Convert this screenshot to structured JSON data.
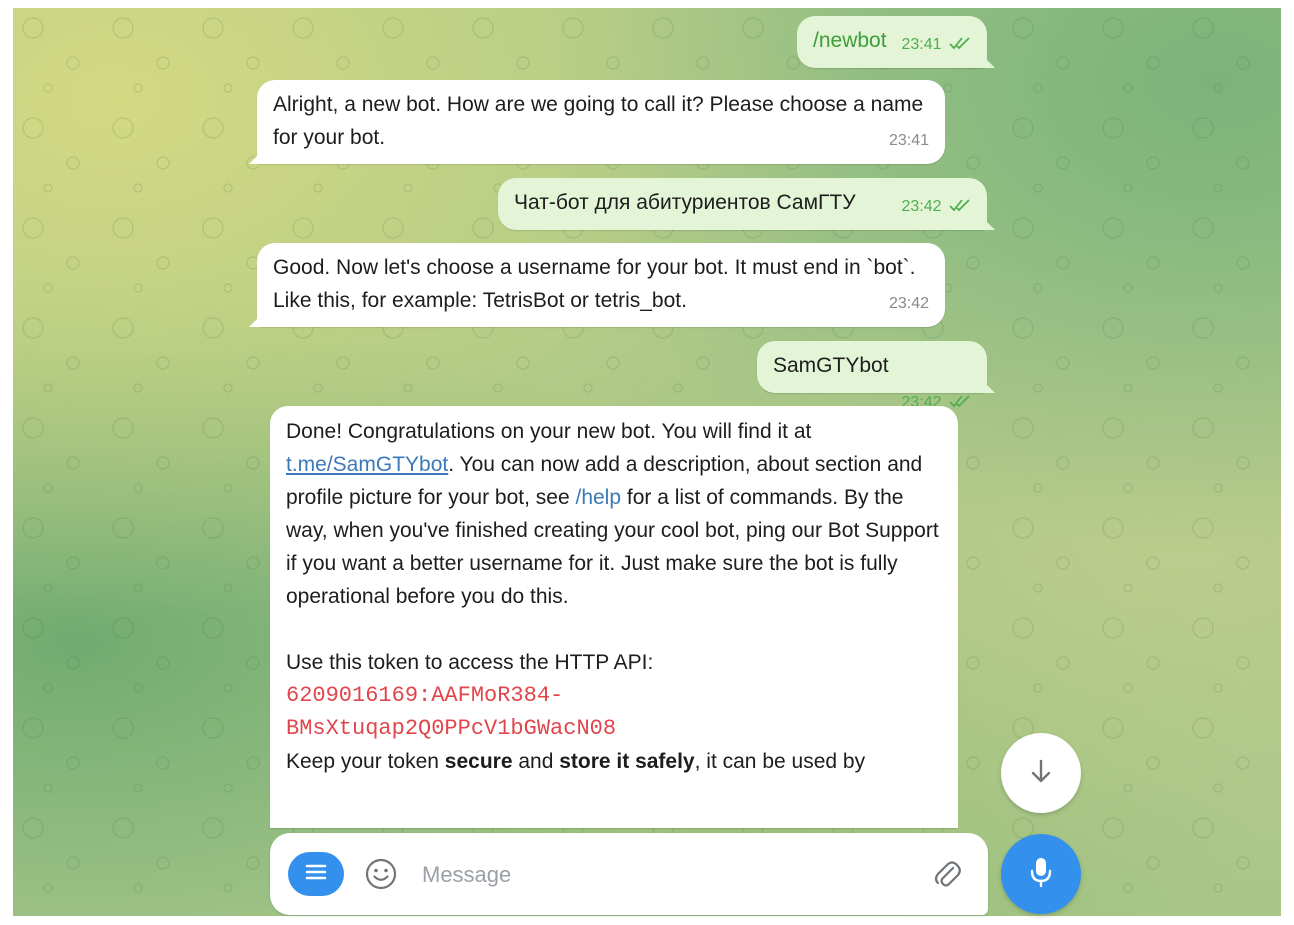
{
  "messages": [
    {
      "direction": "out",
      "text": "/newbot",
      "time": "23:41"
    },
    {
      "direction": "in",
      "text": "Alright, a new bot. How are we going to call it? Please choose a name for your bot.",
      "time": "23:41"
    },
    {
      "direction": "out",
      "text": "Чат-бот для абитуриентов СамГТУ",
      "time": "23:42"
    },
    {
      "direction": "in",
      "text": "Good. Now let's choose a username for your bot. It must end in `bot`. Like this, for example: TetrisBot or tetris_bot.",
      "time": "23:42"
    },
    {
      "direction": "out",
      "text": "SamGTYbot",
      "time": "23:42"
    }
  ],
  "done_message": {
    "p1_a": "Done! Congratulations on your new bot. You will find it at ",
    "link": "t.me/SamGTYbot",
    "p1_b": ". You can now add a description, about section and profile picture for your bot, see ",
    "help_cmd": "/help",
    "p1_c": " for a list of commands. By the way, when you've finished creating your cool bot, ping our Bot Support if you want a better username for it. Just make sure the bot is fully operational before you do this.",
    "p2": "Use this token to access the HTTP API:",
    "token_line1": "6209016169:AAFMoR384-",
    "token_line2": "BMsXtuqap2Q0PPcV1bGWacN08",
    "p3_a": "Keep your token ",
    "p3_secure": "secure",
    "p3_b": " and ",
    "p3_store": "store it safely",
    "p3_c": ", it can be used by"
  },
  "composer": {
    "placeholder": "Message"
  },
  "icons": {
    "menu": "menu-icon",
    "emoji": "smile-icon",
    "attach": "paperclip-icon",
    "scroll_down": "arrow-down-icon",
    "mic": "microphone-icon",
    "read": "double-check-icon"
  },
  "colors": {
    "accent": "#3390ec",
    "outgoing_bubble": "#e3f5d6",
    "token": "#e0464b",
    "link": "#3b79b9"
  }
}
